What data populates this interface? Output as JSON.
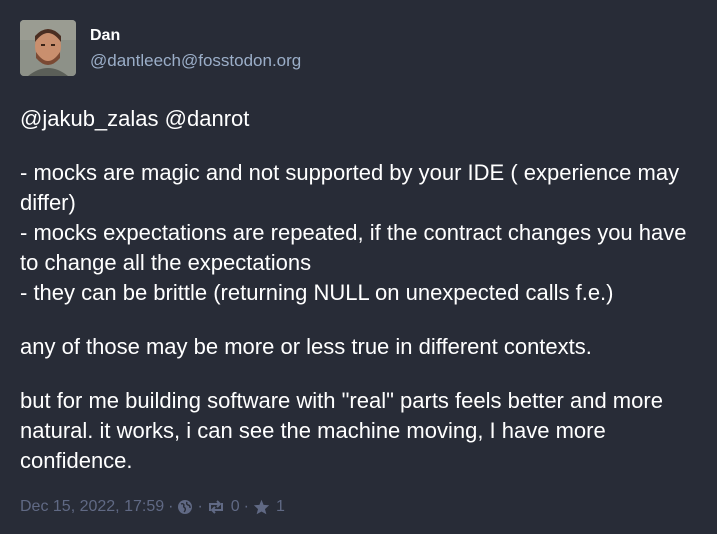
{
  "author": {
    "display_name": "Dan",
    "handle": "@dantleech@fosstodon.org"
  },
  "content": {
    "mentions": [
      "@jakub_zalas",
      "@danrot"
    ],
    "bullets": [
      "- mocks are magic and not supported by your IDE ( experience may differ)",
      "- mocks expectations are repeated, if the contract changes you have to change all the expectations",
      "- they can be brittle (returning NULL on unexpected calls f.e.)"
    ],
    "paragraph_2": "any of those may be more or less true in different contexts.",
    "paragraph_3": "but for me building software with \"real\" parts feels better and more natural. it works, i can see the machine moving, I have more confidence."
  },
  "meta": {
    "timestamp": "Dec 15, 2022, 17:59",
    "separator": "·",
    "visibility_icon": "globe-icon",
    "boost_icon": "retweet-icon",
    "boost_count": "0",
    "favourite_icon": "star-icon",
    "favourite_count": "1"
  },
  "colors": {
    "background": "#282c37",
    "text": "#ffffff",
    "handle": "#9baec8",
    "meta": "#606984"
  }
}
